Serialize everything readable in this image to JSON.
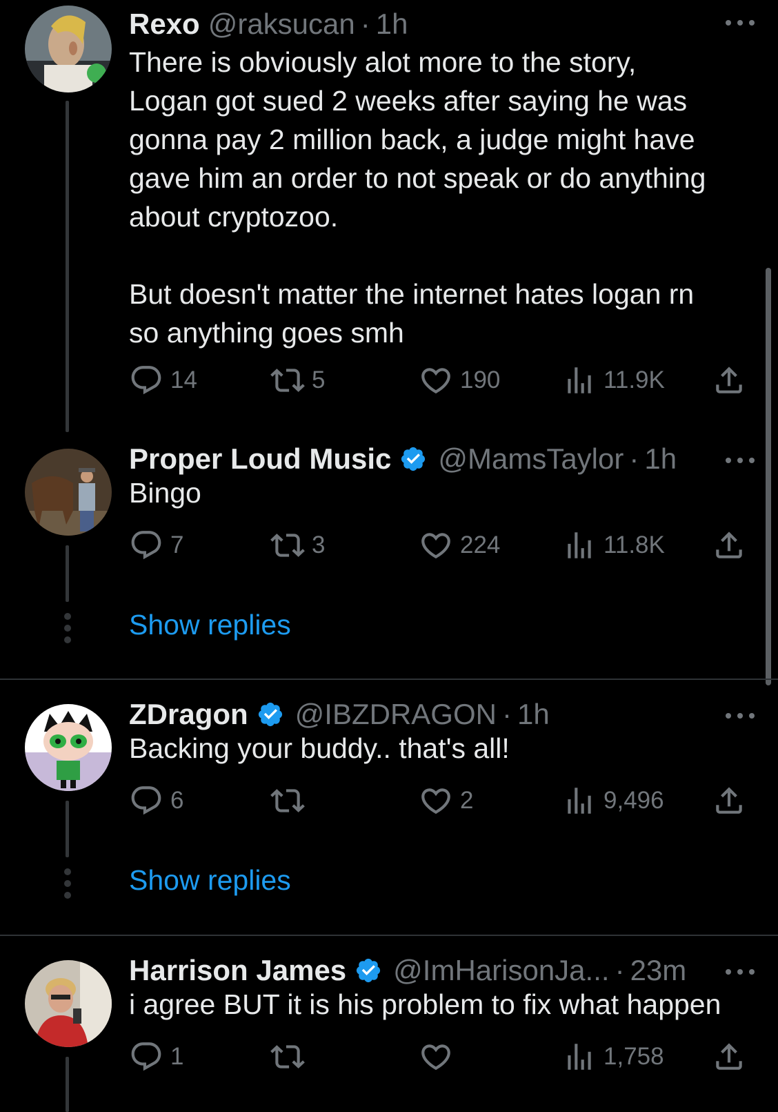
{
  "tweets": [
    {
      "name": "Rexo",
      "verified": false,
      "handle": "@raksucan",
      "dot": "·",
      "time": "1h",
      "text": "There is obviously alot more to the story,\nLogan got sued 2 weeks after saying he was\ngonna pay 2 million back, a judge might have\ngave him an order to not speak or do anything\nabout cryptozoo.\n\nBut doesn't matter the internet hates logan rn\nso anything goes smh",
      "replies": "14",
      "retweets": "5",
      "likes": "190",
      "views": "11.9K"
    },
    {
      "name": "Proper Loud Music",
      "verified": true,
      "handle": "@MamsTaylor",
      "dot": "·",
      "time": "1h",
      "text": "Bingo",
      "replies": "7",
      "retweets": "3",
      "likes": "224",
      "views": "11.8K",
      "show_replies": "Show replies"
    },
    {
      "name": "ZDragon",
      "verified": true,
      "handle": "@IBZDRAGON",
      "dot": "·",
      "time": "1h",
      "text": "Backing your buddy.. that's all!",
      "replies": "6",
      "retweets": "",
      "likes": "2",
      "views": "9,496",
      "show_replies": "Show replies"
    },
    {
      "name": "Harrison James",
      "verified": true,
      "handle": "@ImHarisonJa...",
      "dot": "·",
      "time": "23m",
      "text": "i agree BUT it is his problem to fix what happen",
      "replies": "1",
      "retweets": "",
      "likes": "",
      "views": "1,758"
    }
  ],
  "icons": {
    "reply": "reply-icon",
    "retweet": "retweet-icon",
    "like": "heart-icon",
    "views": "views-icon",
    "share": "share-icon",
    "more": "more-icon",
    "verified": "verified-badge-icon"
  },
  "colors": {
    "background": "#000000",
    "text": "#e7e9ea",
    "muted": "#71767b",
    "accent": "#1d9bf0"
  }
}
